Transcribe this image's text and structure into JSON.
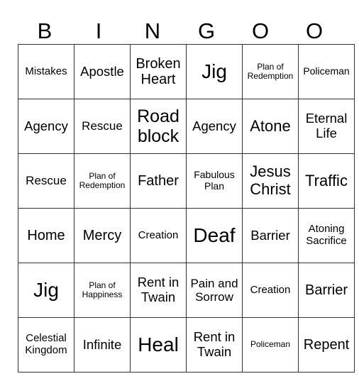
{
  "header": {
    "letters": [
      "B",
      "I",
      "N",
      "G",
      "O",
      "O"
    ]
  },
  "rows": [
    [
      "Mistakes",
      "Apostle",
      "Broken Heart",
      "Jig",
      "Plan of Redemption",
      "Policeman"
    ],
    [
      "Agency",
      "Rescue",
      "Road block",
      "Agency",
      "Atone",
      "Eternal Life"
    ],
    [
      "Rescue",
      "Plan of Redemption",
      "Father",
      "Fabulous Plan",
      "Jesus Christ",
      "Traffic"
    ],
    [
      "Home",
      "Mercy",
      "Creation",
      "Deaf",
      "Barrier",
      "Atoning Sacrifice"
    ],
    [
      "Jig",
      "Plan of Happiness",
      "Rent in Twain",
      "Pain and Sorrow",
      "Creation",
      "Barrier"
    ],
    [
      "Celestial Kingdom",
      "Infinite",
      "Heal",
      "Rent in Twain",
      "Policeman",
      "Repent"
    ]
  ]
}
